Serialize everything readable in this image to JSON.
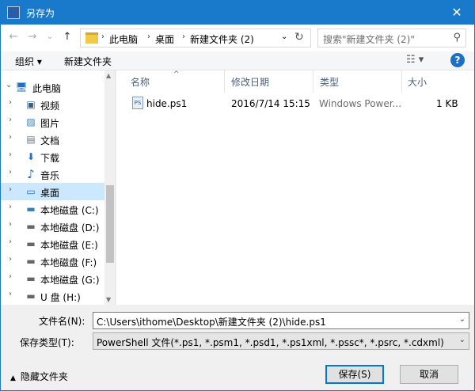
{
  "window": {
    "title": "另存为",
    "close_glyph": "✕"
  },
  "nav": {
    "back_glyph": "←",
    "forward_glyph": "→",
    "recent_glyph": "⌄",
    "up_glyph": "↑",
    "breadcrumbs": [
      "此电脑",
      "桌面",
      "新建文件夹 (2)"
    ],
    "separator": "›",
    "dropdown_glyph": "⌄",
    "refresh_glyph": "↻",
    "search_placeholder": "搜索\"新建文件夹 (2)\"",
    "search_glyph": "⚲"
  },
  "commands": {
    "organize": "组织 ▾",
    "new_folder": "新建文件夹",
    "view_glyph": "☷ ▾",
    "help_glyph": "?"
  },
  "sidebar": {
    "items": [
      {
        "label": "此电脑",
        "icon": "computer-icon",
        "glyph": "🖥",
        "root": true,
        "chevron": "⌄"
      },
      {
        "label": "视频",
        "icon": "video-icon",
        "glyph": "▣",
        "chevron": "›"
      },
      {
        "label": "图片",
        "icon": "picture-icon",
        "glyph": "▨",
        "chevron": "›"
      },
      {
        "label": "文档",
        "icon": "document-icon",
        "glyph": "▤",
        "chevron": "›"
      },
      {
        "label": "下载",
        "icon": "download-icon",
        "glyph": "⬇",
        "chevron": "›"
      },
      {
        "label": "音乐",
        "icon": "music-icon",
        "glyph": "♪",
        "chevron": "›"
      },
      {
        "label": "桌面",
        "icon": "desktop-icon",
        "glyph": "▭",
        "chevron": "›",
        "selected": true
      },
      {
        "label": "本地磁盘 (C:)",
        "icon": "system-drive-icon",
        "glyph": "▬",
        "chevron": "›"
      },
      {
        "label": "本地磁盘 (D:)",
        "icon": "drive-icon",
        "glyph": "▬",
        "chevron": "›"
      },
      {
        "label": "本地磁盘 (E:)",
        "icon": "drive-icon",
        "glyph": "▬",
        "chevron": "›"
      },
      {
        "label": "本地磁盘 (F:)",
        "icon": "drive-icon",
        "glyph": "▬",
        "chevron": "›"
      },
      {
        "label": "本地磁盘 (G:)",
        "icon": "drive-icon",
        "glyph": "▬",
        "chevron": "›"
      },
      {
        "label": "U 盘 (H:)",
        "icon": "usb-drive-icon",
        "glyph": "▬",
        "chevron": "›"
      }
    ]
  },
  "filelist": {
    "headers": {
      "name": "名称",
      "modified": "修改日期",
      "type": "类型",
      "size": "大小"
    },
    "files": [
      {
        "name": "hide.ps1",
        "modified": "2016/7/14 15:15",
        "type": "Windows Power...",
        "size": "1 KB",
        "icon_text": "PS"
      }
    ]
  },
  "form": {
    "filename_label": "文件名(N):",
    "filename_value": "C:\\Users\\ithome\\Desktop\\新建文件夹 (2)\\hide.ps1",
    "filetype_label": "保存类型(T):",
    "filetype_value": "PowerShell 文件(*.ps1, *.psm1, *.psd1, *.ps1xml, *.pssc*, *.psrc, *.cdxml)",
    "dropdown_glyph": "⌄",
    "hide_folders": "隐藏文件夹",
    "hide_caret": "▲",
    "save_label": "保存(S)",
    "cancel_label": "取消"
  },
  "colors": {
    "title_bar": "#1979ca",
    "selection": "#cce8ff",
    "primary_border": "#0078d7"
  }
}
